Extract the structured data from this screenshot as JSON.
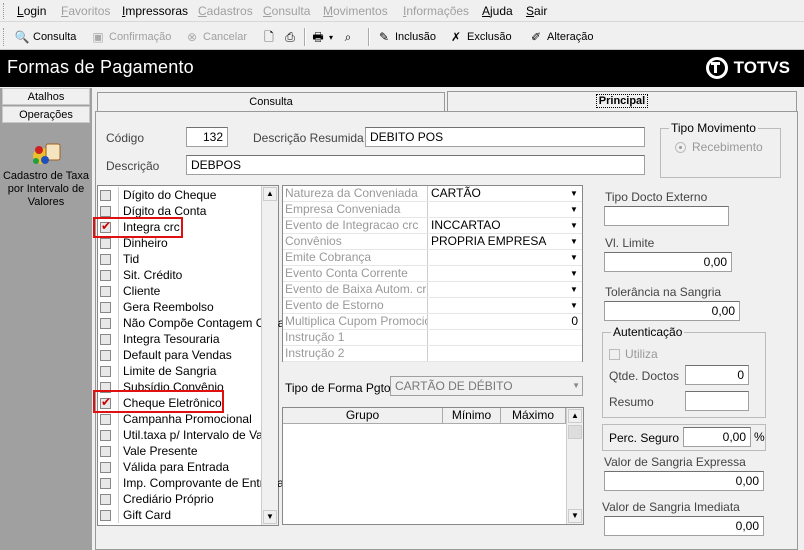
{
  "menu": [
    {
      "label": "Login",
      "enabled": true
    },
    {
      "label": "Favoritos",
      "enabled": false
    },
    {
      "label": "Impressoras",
      "enabled": true
    },
    {
      "label": "Cadastros",
      "enabled": false
    },
    {
      "label": "Consulta",
      "enabled": false
    },
    {
      "label": "Movimentos",
      "enabled": false
    },
    {
      "label": "Informações",
      "enabled": false
    },
    {
      "label": "Ajuda",
      "enabled": true
    },
    {
      "label": "Sair",
      "enabled": true
    }
  ],
  "toolbar": {
    "consulta": "Consulta",
    "confirmacao": "Confirmação",
    "cancelar": "Cancelar",
    "inclusao": "Inclusão",
    "exclusao": "Exclusão",
    "alteracao": "Alteração"
  },
  "title": "Formas de Pagamento",
  "brand": "TOTVS",
  "left": {
    "atalhos": "Atalhos",
    "operacoes": "Operações",
    "item": "Cadastro de Taxa por Intervalo de Valores"
  },
  "tabs": {
    "consulta": "Consulta",
    "principal": "Principal"
  },
  "form": {
    "codigo_label": "Código",
    "codigo_value": "132",
    "descres_label": "Descrição Resumida",
    "descres_value": "DEBITO POS",
    "descricao_label": "Descrição",
    "descricao_value": "DEBPOS",
    "tipomov_label": "Tipo Movimento",
    "tipomov_option": "Recebimento"
  },
  "checklist": [
    {
      "label": "Dígito do Cheque",
      "checked": false
    },
    {
      "label": "Dígito da Conta",
      "checked": false
    },
    {
      "label": "Integra crc",
      "checked": true
    },
    {
      "label": "Dinheiro",
      "checked": false
    },
    {
      "label": "Tid",
      "checked": false
    },
    {
      "label": "Sit. Crédito",
      "checked": false
    },
    {
      "label": "Cliente",
      "checked": false
    },
    {
      "label": "Gera Reembolso",
      "checked": false
    },
    {
      "label": "Não Compõe Contagem Cega",
      "checked": false
    },
    {
      "label": "Integra Tesouraria",
      "checked": false
    },
    {
      "label": "Default para Vendas",
      "checked": false
    },
    {
      "label": "Limite de Sangria",
      "checked": false
    },
    {
      "label": "Subsídio Convênio",
      "checked": false
    },
    {
      "label": "Cheque Eletrônico",
      "checked": true
    },
    {
      "label": "Campanha Promocional",
      "checked": false
    },
    {
      "label": "Util.taxa p/ Intervalo de Valor.",
      "checked": false
    },
    {
      "label": "Vale Presente",
      "checked": false
    },
    {
      "label": "Válida para Entrada",
      "checked": false
    },
    {
      "label": "Imp. Comprovante de Entrega",
      "checked": false
    },
    {
      "label": "Crediário Próprio",
      "checked": false
    },
    {
      "label": "Gift Card",
      "checked": false
    }
  ],
  "props": [
    {
      "key": "Natureza da Conveniada",
      "value": "CARTÃO",
      "dropdown": true
    },
    {
      "key": "Empresa Conveniada",
      "value": "",
      "dropdown": true
    },
    {
      "key": "Evento de Integracao crc",
      "value": "INCCARTAO",
      "dropdown": true
    },
    {
      "key": "Convênios",
      "value": "PROPRIA EMPRESA",
      "dropdown": true
    },
    {
      "key": "Emite Cobrança",
      "value": "",
      "dropdown": true
    },
    {
      "key": "Evento Conta Corrente",
      "value": "",
      "dropdown": true
    },
    {
      "key": "Evento de Baixa Autom. crc",
      "value": "",
      "dropdown": true
    },
    {
      "key": "Evento de Estorno",
      "value": "",
      "dropdown": true
    },
    {
      "key": "Multiplica Cupom Promocional",
      "value": "0",
      "dropdown": false
    },
    {
      "key": "Instrução 1",
      "value": "",
      "dropdown": false
    },
    {
      "key": "Instrução 2",
      "value": "",
      "dropdown": false
    }
  ],
  "tipoforma": {
    "label": "Tipo de Forma Pgto",
    "value": "CARTÃO DE DÉBITO"
  },
  "grupo_table": {
    "headers": [
      "Grupo",
      "Mínimo",
      "Máximo"
    ]
  },
  "right": {
    "tipodocto_label": "Tipo Docto Externo",
    "tipodocto_value": "",
    "vlimite_label": "Vl. Limite",
    "vlimite_value": "0,00",
    "tolerancia_label": "Tolerância na Sangria",
    "tolerancia_value": "0,00",
    "autenticacao_label": "Autenticação",
    "utiliza_label": "Utiliza",
    "qtdedoctos_label": "Qtde. Doctos",
    "qtdedoctos_value": "0",
    "resumo_label": "Resumo",
    "resumo_value": "",
    "percseguro_label": "Perc. Seguro",
    "percseguro_value": "0,00",
    "percseguro_unit": "%",
    "sangriaexp_label": "Valor de Sangria Expressa",
    "sangriaexp_value": "0,00",
    "sangriaimed_label": "Valor de Sangria Imediata",
    "sangriaimed_value": "0,00"
  }
}
